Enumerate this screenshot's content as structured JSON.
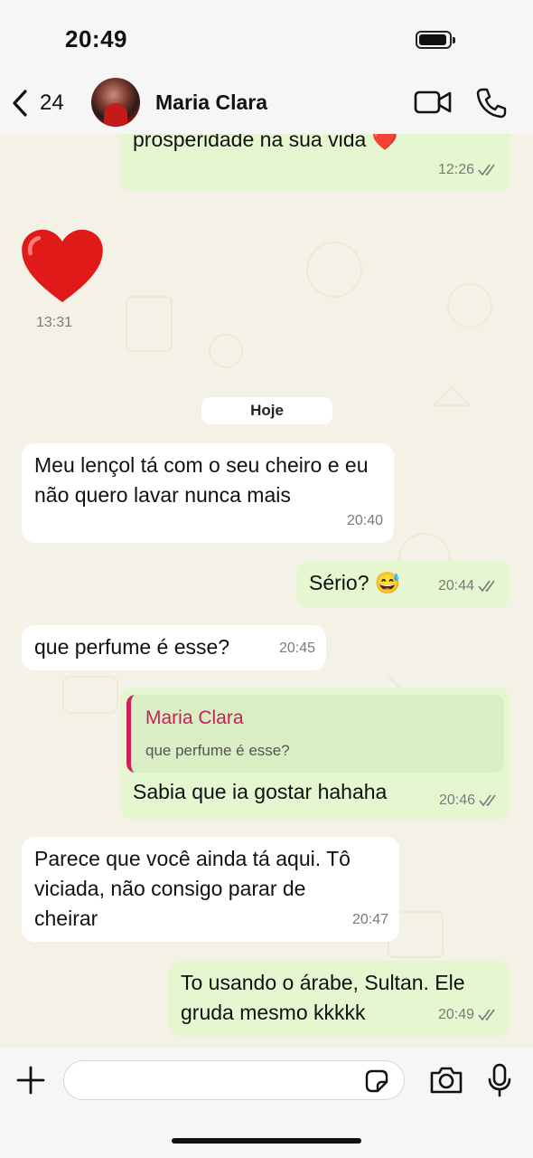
{
  "status_bar": {
    "time": "20:49"
  },
  "header": {
    "back_count": "24",
    "contact_name": "Maria Clara"
  },
  "day_separator": "Hoje",
  "messages": [
    {
      "direction": "out",
      "text": "prosperidade na sua vida ❤️",
      "time": "12:26"
    },
    {
      "direction": "in",
      "text": "❤️",
      "time": "13:31"
    },
    {
      "direction": "in",
      "text": "Meu lençol tá com o seu cheiro e eu não quero lavar nunca mais",
      "time": "20:40"
    },
    {
      "direction": "out",
      "text": "Sério? 😅",
      "time": "20:44"
    },
    {
      "direction": "in",
      "text": "que perfume é esse?",
      "time": "20:45"
    },
    {
      "direction": "out",
      "reply_to_name": "Maria Clara",
      "reply_to_text": "que perfume é esse?",
      "text": "Sabia que ia gostar hahaha",
      "time": "20:46"
    },
    {
      "direction": "in",
      "text": "Parece que você ainda tá aqui. Tô viciada, não consigo parar de cheirar",
      "time": "20:47"
    },
    {
      "direction": "out",
      "text": "To usando o árabe, Sultan. Ele gruda mesmo kkkkk",
      "time": "20:49"
    }
  ],
  "composer": {
    "value": "",
    "placeholder": ""
  },
  "icons": {
    "back": "chevron-left-icon",
    "video": "video-icon",
    "call": "phone-icon",
    "plus": "plus-icon",
    "sticker": "sticker-icon",
    "camera": "camera-icon",
    "mic": "microphone-icon",
    "read_ticks": "double-check-icon"
  },
  "colors": {
    "outgoing_bubble": "#e5f7d0",
    "incoming_bubble": "#ffffff",
    "reply_accent": "#c6215e",
    "read_ticks": "#7a7a7a"
  }
}
